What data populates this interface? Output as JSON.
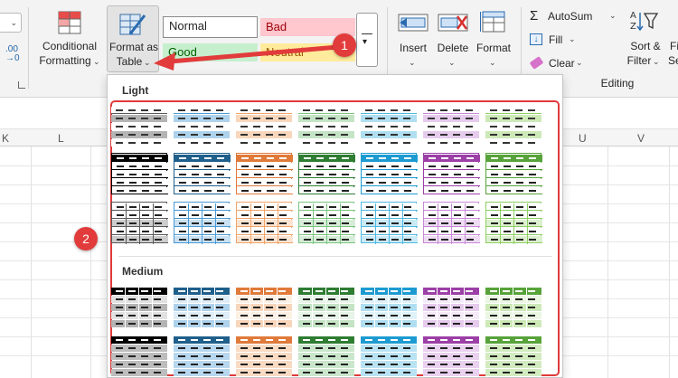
{
  "ribbon": {
    "left_fragment": ".00",
    "left_fragment2": "→0",
    "conditional_formatting": {
      "line1": "Conditional",
      "line2": "Formatting"
    },
    "format_as_table": {
      "line1": "Format as",
      "line2": "Table"
    },
    "styles": [
      {
        "label": "Normal",
        "bg": "#ffffff",
        "fg": "#222222"
      },
      {
        "label": "Bad",
        "bg": "#ffc7ce",
        "fg": "#9c0006"
      },
      {
        "label": "Good",
        "bg": "#c6efce",
        "fg": "#006100"
      },
      {
        "label": "Neutral",
        "bg": "#ffeb9c",
        "fg": "#9c5700"
      }
    ],
    "insert_label": "Insert",
    "delete_label": "Delete",
    "format_label": "Format",
    "autosum_label": "AutoSum",
    "fill_label": "Fill",
    "clear_label": "Clear",
    "editing_group": "Editing",
    "sort_filter": {
      "line1": "Sort &",
      "line2": "Filter"
    },
    "find_fragment": {
      "line1": "Fi",
      "line2": "Se"
    }
  },
  "columns": [
    "K",
    "L",
    "U",
    "V"
  ],
  "panel": {
    "light_title": "Light",
    "medium_title": "Medium",
    "accent_colors": [
      "#595959",
      "#4a9ad4",
      "#f0a46a",
      "#7bc47f",
      "#4fb8e0",
      "#c78bd6",
      "#8fce62"
    ],
    "dark_colors": [
      "#000000",
      "#1f5f8b",
      "#e07a3a",
      "#2e7d32",
      "#1d9bd1",
      "#9c3fa7",
      "#57a33a"
    ]
  },
  "badges": {
    "one": "1",
    "two": "2"
  },
  "colors": {
    "annotation_red": "#e23b3b",
    "ribbon_bg": "#f3f3f3"
  }
}
